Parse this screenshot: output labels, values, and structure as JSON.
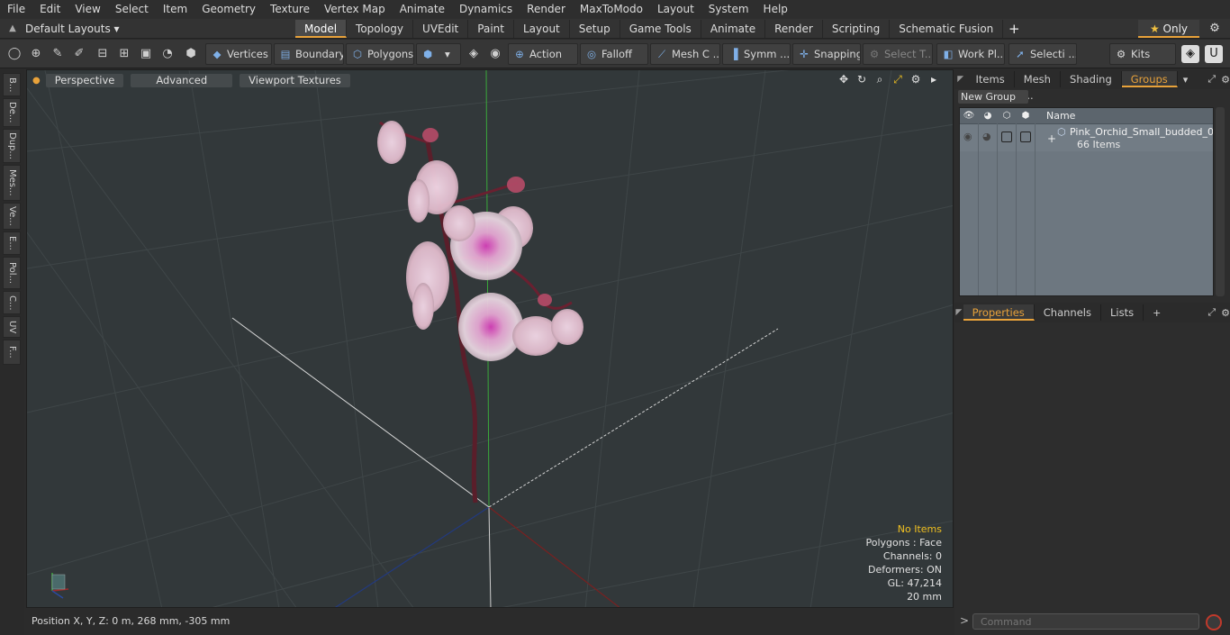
{
  "menu": [
    "File",
    "Edit",
    "View",
    "Select",
    "Item",
    "Geometry",
    "Texture",
    "Vertex Map",
    "Animate",
    "Dynamics",
    "Render",
    "MaxToModo",
    "Layout",
    "System",
    "Help"
  ],
  "layout_select": "Default Layouts ▾",
  "layout_tabs": [
    "Model",
    "Topology",
    "UVEdit",
    "Paint",
    "Layout",
    "Setup",
    "Game Tools",
    "Animate",
    "Render",
    "Scripting",
    "Schematic Fusion"
  ],
  "active_tab": "Model",
  "only_label": "Only",
  "toolbar": {
    "vertices": "Vertices",
    "boundary": "Boundary",
    "polygons": "Polygons",
    "action": "Action",
    "falloff": "Falloff",
    "mesh": "Mesh C ...",
    "symm": "Symm ...",
    "snapping": "Snapping",
    "select_t": "Select T...",
    "work_plane": "Work Pl...",
    "selecti": "Selecti ...",
    "kits": "Kits"
  },
  "left_tabs": [
    "B...",
    "De...",
    "Dup...",
    "Mes...",
    "Ve...",
    "E...",
    "Pol...",
    "C...",
    "UV",
    "F..."
  ],
  "viewport": {
    "perspective": "Perspective",
    "advanced": "Advanced",
    "textures": "Viewport Textures"
  },
  "stats": {
    "items": "No Items",
    "polygons": "Polygons : Face",
    "channels": "Channels: 0",
    "deformers": "Deformers: ON",
    "gl": "GL: 47,214",
    "scale": "20 mm"
  },
  "status": "Position X, Y, Z:   0 m, 268 mm, -305 mm",
  "groups_tabs": [
    "Items",
    "Mesh ...",
    "Shading",
    "Groups"
  ],
  "new_group": "New Group",
  "groups_col_name": "Name",
  "group_item": {
    "name": "Pink_Orchid_Small_budded_0 ...",
    "count": "66 Items"
  },
  "props_tabs": [
    "Properties",
    "Channels",
    "Lists"
  ],
  "command_placeholder": "Command",
  "colors": {
    "accent": "#e8a23a",
    "groups_bg": "#6d7780",
    "viewport_bg": "#32383a"
  }
}
